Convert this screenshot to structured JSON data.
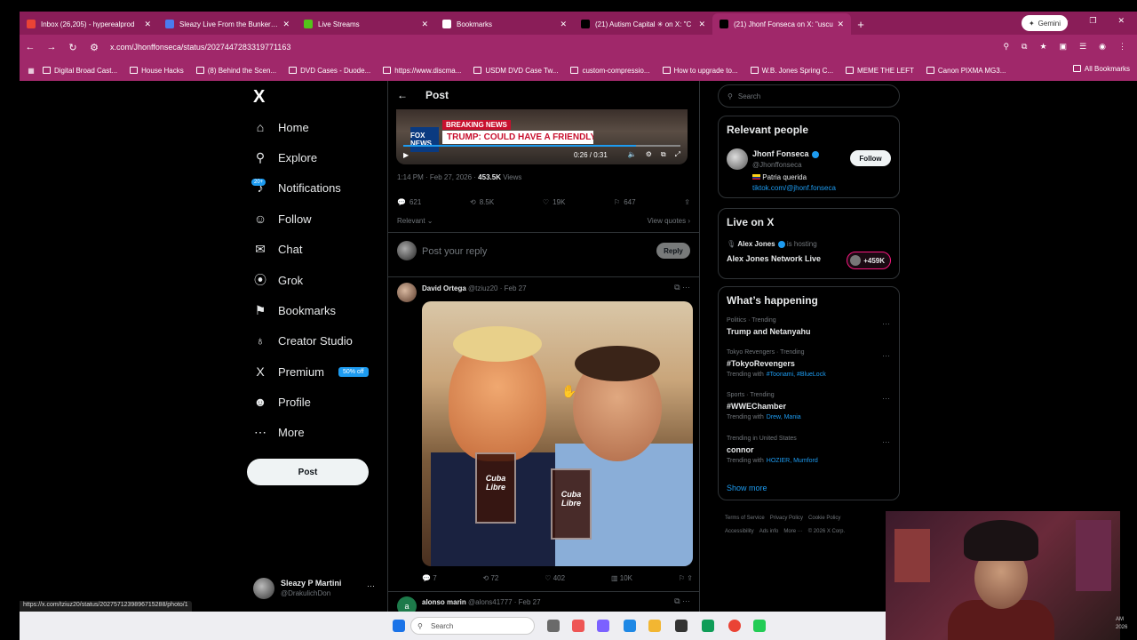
{
  "browser": {
    "tabs": [
      {
        "title": "Inbox (26,205) - hyperealprod",
        "color": "#ea4335",
        "active": false
      },
      {
        "title": "Sleazy Live From the Bunker 2/2",
        "color": "#4a7cf0",
        "active": false
      },
      {
        "title": "Live Streams",
        "color": "#53c41a",
        "active": false
      },
      {
        "title": "Bookmarks",
        "color": "#ffffff",
        "active": false
      },
      {
        "title": "(21) Autism Capital ✳ on X: \"C",
        "color": "#000000",
        "active": false
      },
      {
        "title": "(21) Jhonf Fonseca on X: \"uscu",
        "color": "#000000",
        "active": true
      }
    ],
    "gemini_label": "Gemini",
    "url": "x.com/Jhonffonseca/status/2027447283319771163",
    "bookmarks": [
      "Digital Broad Cast...",
      "House Hacks",
      "(8) Behind the Scen...",
      "DVD Cases - Duode...",
      "https://www.discma...",
      "USDM DVD Case Tw...",
      "custom-compressio...",
      "How to upgrade to...",
      "W.B. Jones Spring C...",
      "MEME THE LEFT",
      "Canon PIXMA MG3..."
    ],
    "all_bookmarks": "All Bookmarks",
    "status_url": "https://x.com/tziuz20/status/2027571239896715288/photo/1"
  },
  "leftnav": {
    "logo": "X",
    "items": [
      {
        "label": "Home",
        "icon": "⌂"
      },
      {
        "label": "Explore",
        "icon": "⚲"
      },
      {
        "label": "Notifications",
        "icon": "♪"
      },
      {
        "label": "Follow",
        "icon": "☺"
      },
      {
        "label": "Chat",
        "icon": "✉"
      },
      {
        "label": "Grok",
        "icon": "⦿"
      },
      {
        "label": "Bookmarks",
        "icon": "⚑"
      },
      {
        "label": "Creator Studio",
        "icon": "♁"
      },
      {
        "label": "Premium",
        "icon": "X"
      },
      {
        "label": "Profile",
        "icon": "☻"
      },
      {
        "label": "More",
        "icon": "⋯"
      }
    ],
    "notif_badge": "20+",
    "premium_badge": "50% off",
    "post_label": "Post",
    "account": {
      "name": "Sleazy P Martini",
      "handle": "@DrakulichDon"
    }
  },
  "post": {
    "header": "Post",
    "video": {
      "breaking": "BREAKING NEWS",
      "headline": "TRUMP: COULD HAVE A FRIENDLY",
      "network": "FOX NEWS",
      "time": "0:26 / 0:31",
      "progress": 0.84
    },
    "timestamp": "1:14 PM · Feb 27, 2026 ·",
    "views_count": "453.5K",
    "views_label": "Views",
    "stats": {
      "replies": "621",
      "reposts": "8.5K",
      "likes": "19K",
      "bookmarks": "647"
    },
    "relevant": "Relevant",
    "view_quotes": "View quotes",
    "reply_placeholder": "Post your reply",
    "reply_button": "Reply"
  },
  "replies": [
    {
      "name": "David Ortega",
      "handle": "@tziuz20 · Feb 27",
      "stats": {
        "replies": "7",
        "reposts": "72",
        "likes": "402",
        "views": "10K"
      },
      "glass_text": "Cuba Libre"
    },
    {
      "name": "alonso marin",
      "handle": "@alons41777 · Feb 27"
    }
  ],
  "right": {
    "search_placeholder": "Search",
    "relevant_people": {
      "title": "Relevant people",
      "name": "Jhonf Fonseca",
      "handle": "@Jhonffonseca",
      "bio": "Patria querida",
      "link": "tiktok.com/@jhonf.fonseca",
      "follow": "Follow"
    },
    "live": {
      "title": "Live on X",
      "host": "Alex Jones",
      "hosting": "is hosting",
      "show": "Alex Jones Network Live",
      "count": "+459K"
    },
    "happening": {
      "title": "What’s happening",
      "items": [
        {
          "meta": "Politics · Trending",
          "topic": "Trump and Netanyahu",
          "with": ""
        },
        {
          "meta": "Tokyo Revengers · Trending",
          "topic": "#TokyoRevengers",
          "with": "Trending with",
          "tags": "#Toonami, #BlueLock"
        },
        {
          "meta": "Sports · Trending",
          "topic": "#WWEChamber",
          "with": "Trending with",
          "tags": "Drew, Mania"
        },
        {
          "meta": "Trending in United States",
          "topic": "connor",
          "with": "Trending with",
          "tags": "HOZIER, Mumford"
        }
      ],
      "show_more": "Show more"
    },
    "footer": [
      "Terms of Service",
      "Privacy Policy",
      "Cookie Policy",
      "Accessibility",
      "Ads info",
      "More ···",
      "© 2026 X Corp."
    ]
  },
  "taskbar": {
    "search": "Search"
  },
  "clock": {
    "time": "AM",
    "date": "2026"
  }
}
